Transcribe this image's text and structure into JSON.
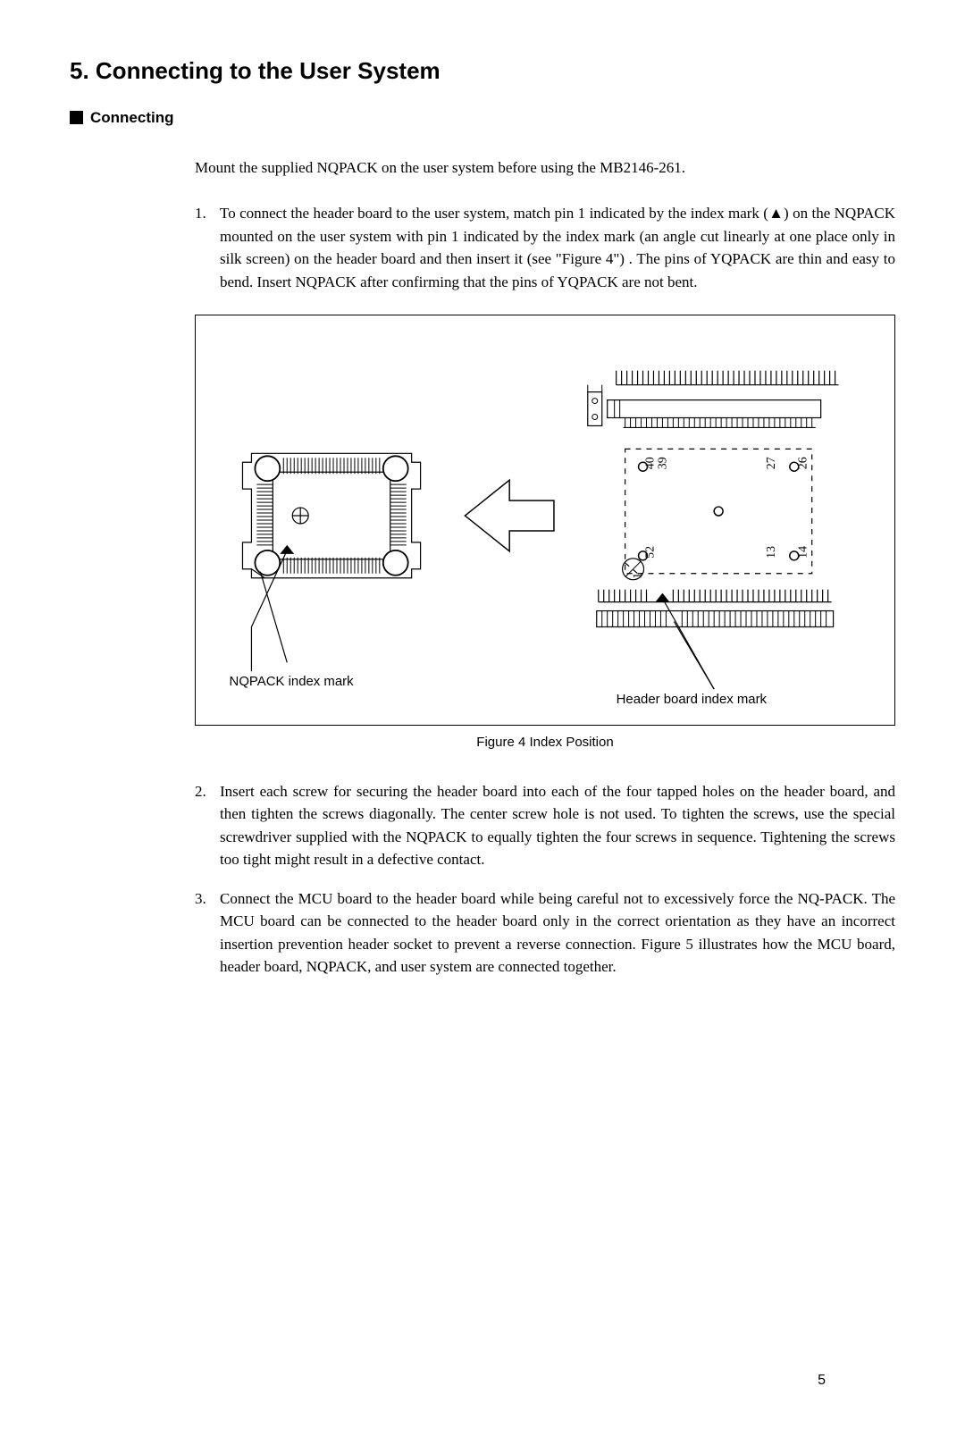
{
  "headings": {
    "section_title": "5. Connecting to the User System",
    "subheading": "Connecting"
  },
  "intro": "Mount the supplied NQPACK on the user system before using the MB2146-261.",
  "steps": {
    "s1": "To connect the header board to the user system, match pin 1 indicated by the index mark (▲) on the NQPACK mounted on the user system with pin 1 indicated by the index mark (an angle cut linearly at one place only in silk screen) on the header board and then insert it (see \"Figure 4\") . The pins of YQPACK are thin and easy to bend. Insert NQPACK after confirming that the pins of YQPACK are not bent.",
    "s2": "Insert each screw for securing the header board into each of the four tapped holes on the header board, and then tighten the screws diagonally. The center screw hole is not used. To tighten the screws, use the special screwdriver supplied with the NQPACK to equally tighten the four screws in sequence. Tightening the screws too tight might result in a defective contact.",
    "s3": "Connect the MCU board to the header board while being careful not to excessively force the NQ-PACK. The MCU board can be connected to the header board only in the correct orientation as they have an incorrect insertion prevention header socket to prevent a reverse connection. Figure 5 illustrates how the MCU board, header board, NQPACK, and user system are connected together."
  },
  "figure": {
    "caption": "Figure 4 Index Position",
    "nqpack_label": "NQPACK index mark",
    "header_label": "Header board index mark",
    "pins": {
      "p1": "1",
      "p13": "13",
      "p14": "14",
      "p26": "26",
      "p27": "27",
      "p39": "39",
      "p40": "40",
      "p52": "52"
    }
  },
  "page_number": "5"
}
